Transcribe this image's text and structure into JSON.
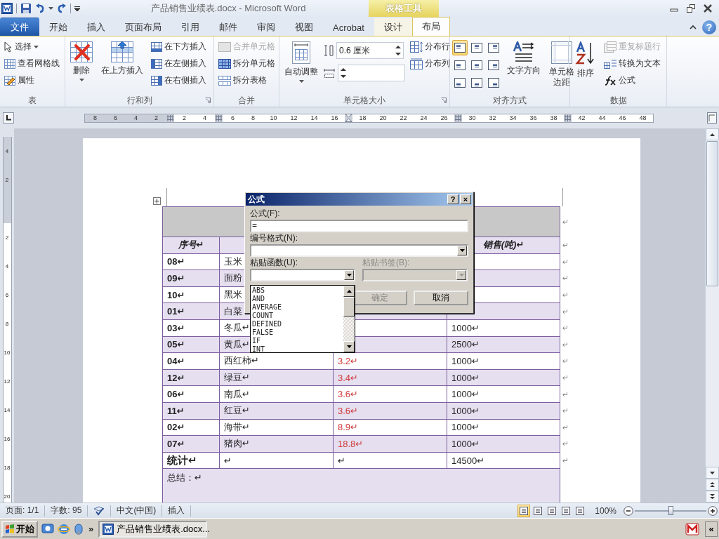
{
  "title_bar": {
    "title": "产品销售业绩表.docx - Microsoft Word",
    "context_label": "表格工具"
  },
  "tabs": [
    {
      "label": "文件",
      "kind": "file",
      "selected": false
    },
    {
      "label": "开始",
      "kind": "tab",
      "selected": false
    },
    {
      "label": "插入",
      "kind": "tab",
      "selected": false
    },
    {
      "label": "页面布局",
      "kind": "tab",
      "selected": false
    },
    {
      "label": "引用",
      "kind": "tab",
      "selected": false
    },
    {
      "label": "邮件",
      "kind": "tab",
      "selected": false
    },
    {
      "label": "审阅",
      "kind": "tab",
      "selected": false
    },
    {
      "label": "视图",
      "kind": "tab",
      "selected": false
    },
    {
      "label": "Acrobat",
      "kind": "tab",
      "selected": false
    },
    {
      "label": "设计",
      "kind": "context",
      "selected": false
    },
    {
      "label": "布局",
      "kind": "context",
      "selected": true
    }
  ],
  "help": "?",
  "ribbon": [
    {
      "label": "表",
      "launcher": false,
      "columns": [
        [
          {
            "kind": "small",
            "label": "选择",
            "dropdown": true,
            "disabled": false
          },
          {
            "kind": "small",
            "label": "查看网格线",
            "dropdown": false,
            "disabled": false
          },
          {
            "kind": "small",
            "label": "属性",
            "dropdown": false,
            "disabled": false
          }
        ]
      ]
    },
    {
      "label": "行和列",
      "launcher": true,
      "columns": [
        [
          {
            "kind": "large",
            "label": "删除",
            "dropdown": true,
            "disabled": false
          }
        ],
        [
          {
            "kind": "large",
            "label": "在上方插入",
            "dropdown": false,
            "disabled": false
          }
        ],
        [
          {
            "kind": "small",
            "label": "在下方插入",
            "dropdown": false,
            "disabled": false
          },
          {
            "kind": "small",
            "label": "在左侧插入",
            "dropdown": false,
            "disabled": false
          },
          {
            "kind": "small",
            "label": "在右侧插入",
            "dropdown": false,
            "disabled": false
          }
        ]
      ]
    },
    {
      "label": "合并",
      "launcher": false,
      "columns": [
        [
          {
            "kind": "small",
            "label": "合并单元格",
            "dropdown": false,
            "disabled": true
          },
          {
            "kind": "small",
            "label": "拆分单元格",
            "dropdown": false,
            "disabled": false
          },
          {
            "kind": "small",
            "label": "拆分表格",
            "dropdown": false,
            "disabled": false
          }
        ]
      ]
    },
    {
      "label": "单元格大小",
      "launcher": true,
      "columns": [
        [
          {
            "kind": "large",
            "label": "自动调整",
            "dropdown": true,
            "disabled": false
          }
        ],
        [
          {
            "kind": "spin",
            "value": "0.6 厘米"
          },
          {
            "kind": "spin"
          }
        ],
        [
          {
            "kind": "small",
            "label": "分布行",
            "dropdown": false,
            "disabled": false
          },
          {
            "kind": "small",
            "label": "分布列",
            "dropdown": false,
            "disabled": false
          }
        ]
      ]
    },
    {
      "label": "对齐方式",
      "launcher": false,
      "columns": [
        [
          {
            "kind": "align_grid",
            "buttons": [
              {
                "selected": true
              },
              {
                "selected": false
              },
              {
                "selected": false
              },
              {
                "selected": false
              },
              {
                "selected": false
              },
              {
                "selected": false
              },
              {
                "selected": false
              },
              {
                "selected": false
              },
              {
                "selected": false
              }
            ]
          }
        ],
        [
          {
            "kind": "large",
            "label": "文字方向",
            "dropdown": false,
            "disabled": false
          }
        ],
        [
          {
            "kind": "large",
            "label": "单元格边距",
            "dropdown": false,
            "disabled": false
          }
        ]
      ]
    },
    {
      "label": "数据",
      "launcher": false,
      "columns": [
        [
          {
            "kind": "large",
            "label": "排序",
            "dropdown": false,
            "disabled": false
          }
        ],
        [
          {
            "kind": "small",
            "label": "重复标题行",
            "dropdown": false,
            "disabled": true
          },
          {
            "kind": "small",
            "label": "转换为文本",
            "dropdown": false,
            "disabled": false
          },
          {
            "kind": "small",
            "label": "公式",
            "dropdown": false,
            "disabled": false
          }
        ]
      ]
    }
  ],
  "ruler": [
    {
      "kind": "number",
      "text": "8"
    },
    {
      "kind": "number",
      "text": "6"
    },
    {
      "kind": "number",
      "text": "4"
    },
    {
      "kind": "number",
      "text": "2"
    },
    {
      "kind": "marker"
    },
    {
      "kind": "number",
      "text": "2"
    },
    {
      "kind": "number",
      "text": "4"
    },
    {
      "kind": "marker"
    },
    {
      "kind": "number",
      "text": "6"
    },
    {
      "kind": "number",
      "text": "8"
    },
    {
      "kind": "number",
      "text": "10"
    },
    {
      "kind": "number",
      "text": "12"
    },
    {
      "kind": "number",
      "text": "14"
    },
    {
      "kind": "number",
      "text": "16"
    },
    {
      "kind": "indent"
    },
    {
      "kind": "number",
      "text": "18"
    },
    {
      "kind": "number",
      "text": "20"
    },
    {
      "kind": "number",
      "text": "22"
    },
    {
      "kind": "number",
      "text": "24"
    },
    {
      "kind": "number",
      "text": "26"
    },
    {
      "kind": "marker"
    },
    {
      "kind": "number",
      "text": "30"
    },
    {
      "kind": "number",
      "text": "32"
    },
    {
      "kind": "number",
      "text": "34"
    },
    {
      "kind": "number",
      "text": "36"
    },
    {
      "kind": "number",
      "text": "38"
    },
    {
      "kind": "marker"
    },
    {
      "kind": "number",
      "text": "42"
    },
    {
      "kind": "number",
      "text": "44"
    },
    {
      "kind": "number",
      "text": "46"
    },
    {
      "kind": "number",
      "text": "48"
    }
  ],
  "vertical_ruler": [
    {
      "kind": "number",
      "text": "4"
    },
    {
      "kind": "number",
      "text": "2"
    },
    {
      "kind": "marker"
    },
    {
      "kind": "number",
      "text": "2"
    },
    {
      "kind": "number",
      "text": "4"
    },
    {
      "kind": "number",
      "text": "6"
    },
    {
      "kind": "number",
      "text": "8"
    },
    {
      "kind": "number",
      "text": "10"
    },
    {
      "kind": "number",
      "text": "12"
    },
    {
      "kind": "number",
      "text": "14"
    },
    {
      "kind": "number",
      "text": "16"
    },
    {
      "kind": "number",
      "text": "18"
    },
    {
      "kind": "number",
      "text": "20"
    }
  ],
  "table": {
    "title_row": {
      "row_end": "↵"
    },
    "header": {
      "column_1": "序号↵",
      "column_4": "销售(吨)↵",
      "row_end": "↵"
    },
    "rows": [
      {
        "column_1": "08↵",
        "column_2": "玉米",
        "row_end": "↵"
      },
      {
        "column_1": "09↵",
        "column_2": "面粉",
        "row_end": "↵"
      },
      {
        "column_1": "10↵",
        "column_2": "黑米",
        "row_end": "↵"
      },
      {
        "column_1": "01↵",
        "column_2": "白菜",
        "row_end": "↵"
      },
      {
        "column_1": "03↵",
        "column_2": "冬瓜↵",
        "column_4": "1000↵",
        "row_end": "↵"
      },
      {
        "column_1": "05↵",
        "column_2": "黄瓜↵",
        "column_4": "2500↵",
        "row_end": "↵"
      },
      {
        "column_1": "04↵",
        "column_2": "西红柿↵",
        "column_3": "3.2↵",
        "column_4": "1000↵",
        "row_end": "↵"
      },
      {
        "column_1": "12↵",
        "column_2": "绿豆↵",
        "column_3": "3.4↵",
        "column_4": "1000↵",
        "row_end": "↵"
      },
      {
        "column_1": "06↵",
        "column_2": "南瓜↵",
        "column_3": "3.6↵",
        "column_4": "1000↵",
        "row_end": "↵"
      },
      {
        "column_1": "11↵",
        "column_2": "红豆↵",
        "column_3": "3.6↵",
        "column_4": "1000↵",
        "row_end": "↵"
      },
      {
        "column_1": "02↵",
        "column_2": "海带↵",
        "column_3": "8.9↵",
        "column_4": "1000↵",
        "row_end": "↵"
      },
      {
        "column_1": "07↵",
        "column_2": "猪肉↵",
        "column_3": "18.8↵",
        "column_4": "1000↵",
        "row_end": "↵"
      }
    ],
    "total": {
      "column_1": "统计↵",
      "column_2": "↵",
      "column_3": "↵",
      "column_4": "14500↵",
      "row_end": "↵"
    },
    "summary": {
      "text": "总结：↵"
    }
  },
  "dialog": {
    "title": "公式",
    "help": "?",
    "close": "×",
    "formula_label": "公式(F):",
    "formula_value": "=",
    "format_label": "编号格式(N):",
    "function_label": "粘贴函数(U):",
    "bookmark_label": "粘贴书签(B):",
    "bookmark_disabled": true,
    "ok": {
      "label": "确定",
      "disabled": true
    },
    "cancel": {
      "label": "取消",
      "disabled": false
    },
    "function_list": [
      "ABS",
      "AND",
      "AVERAGE",
      "COUNT",
      "DEFINED",
      "FALSE",
      "IF",
      "INT"
    ]
  },
  "status_bar": {
    "page": "页面: 1/1",
    "words": "字数: 95",
    "language": "中文(中国)",
    "mode": "插入",
    "views": [
      {
        "selected": true
      },
      {
        "selected": false
      },
      {
        "selected": false
      },
      {
        "selected": false
      },
      {
        "selected": false
      }
    ],
    "zoom_text": "100%",
    "zoom": {
      "level": 0.5
    }
  },
  "taskbar": {
    "start": "开始",
    "more": "»",
    "task": "产品销售业绩表.docx...",
    "collapse": "«"
  }
}
